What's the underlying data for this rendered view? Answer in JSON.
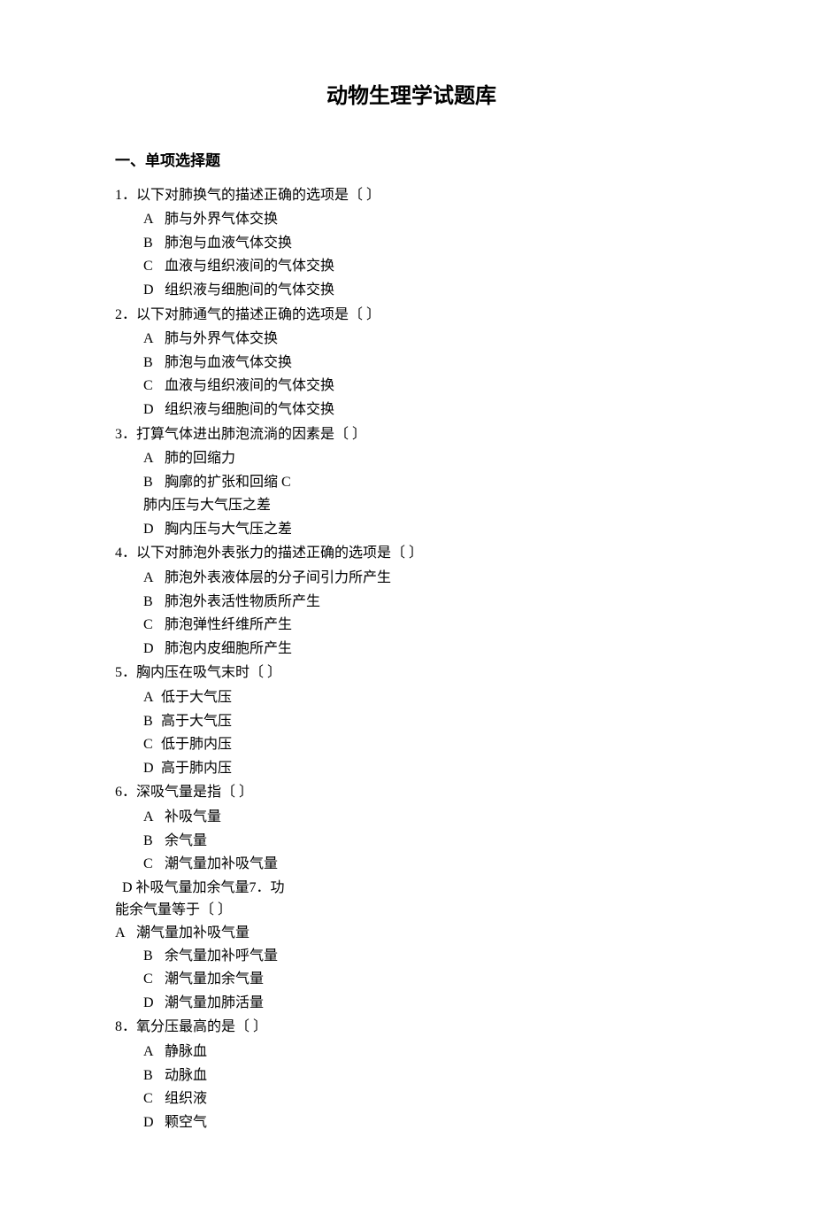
{
  "title": "动物生理学试题库",
  "section_heading": "一、单项选择题",
  "questions": [
    {
      "num": "1．",
      "text": "以下对肺换气的描述正确的选项是〔  〕",
      "options": [
        {
          "letter": "A",
          "text": "肺与外界气体交换"
        },
        {
          "letter": "B",
          "text": "肺泡与血液气体交换"
        },
        {
          "letter": "C",
          "text": "血液与组织液间的气体交换"
        },
        {
          "letter": "D",
          "text": "组织液与细胞间的气体交换"
        }
      ]
    },
    {
      "num": "2．",
      "text": "以下对肺通气的描述正确的选项是〔  〕",
      "options": [
        {
          "letter": "A",
          "text": "肺与外界气体交换"
        },
        {
          "letter": "B",
          "text": "肺泡与血液气体交换"
        },
        {
          "letter": "C",
          "text": "血液与组织液间的气体交换"
        },
        {
          "letter": "D",
          "text": "组织液与细胞间的气体交换"
        }
      ]
    },
    {
      "num": "3．",
      "text": "打算气体进出肺泡流淌的因素是〔          〕",
      "options": [
        {
          "letter": "A",
          "text": "肺的回缩力"
        },
        {
          "letter": "B",
          "text": "胸廓的扩张和回缩  C",
          "wrap": "肺内压与大气压之差"
        },
        {
          "letter": "D",
          "text": "胸内压与大气压之差"
        }
      ]
    },
    {
      "num": "4．",
      "text": "以下对肺泡外表张力的描述正确的选项是〔   〕",
      "options": [
        {
          "letter": "A",
          "text": "肺泡外表液体层的分子间引力所产生"
        },
        {
          "letter": "B",
          "text": "肺泡外表活性物质所产生"
        },
        {
          "letter": "C",
          "text": "肺泡弹性纤维所产生"
        },
        {
          "letter": "D",
          "text": "肺泡内皮细胞所产生"
        }
      ]
    },
    {
      "num": "5．",
      "text": "胸内压在吸气末时〔           〕",
      "options": [
        {
          "letter": "A",
          "text": "低于大气压",
          "tight": true
        },
        {
          "letter": "B",
          "text": "高于大气压",
          "tight": true
        },
        {
          "letter": "C",
          "text": "低于肺内压",
          "tight": true
        },
        {
          "letter": "D",
          "text": "高于肺内压",
          "tight": true
        }
      ]
    },
    {
      "num": "6．",
      "text": "深吸气量是指〔              〕",
      "options": [
        {
          "letter": "A",
          "text": "补吸气量"
        },
        {
          "letter": "B",
          "text": "余气量"
        },
        {
          "letter": "C",
          "text": "潮气量加补吸气量"
        }
      ],
      "trailing_d": "D    补吸气量加余气量7．功",
      "q7_continuation": "能余气量等于〔               〕",
      "q7_option_a": {
        "letter": "A",
        "text": "潮气量加补吸气量"
      },
      "q7_options": [
        {
          "letter": "B",
          "text": "余气量加补呼气量"
        },
        {
          "letter": "C",
          "text": "潮气量加余气量"
        },
        {
          "letter": "D",
          "text": "潮气量加肺活量"
        }
      ]
    },
    {
      "num": "8．",
      "text": "氧分压最高的是〔         〕",
      "options": [
        {
          "letter": "A",
          "text": "静脉血"
        },
        {
          "letter": "B",
          "text": "动脉血"
        },
        {
          "letter": "C",
          "text": "组织液"
        },
        {
          "letter": "D",
          "text": "颗空气"
        }
      ]
    }
  ]
}
